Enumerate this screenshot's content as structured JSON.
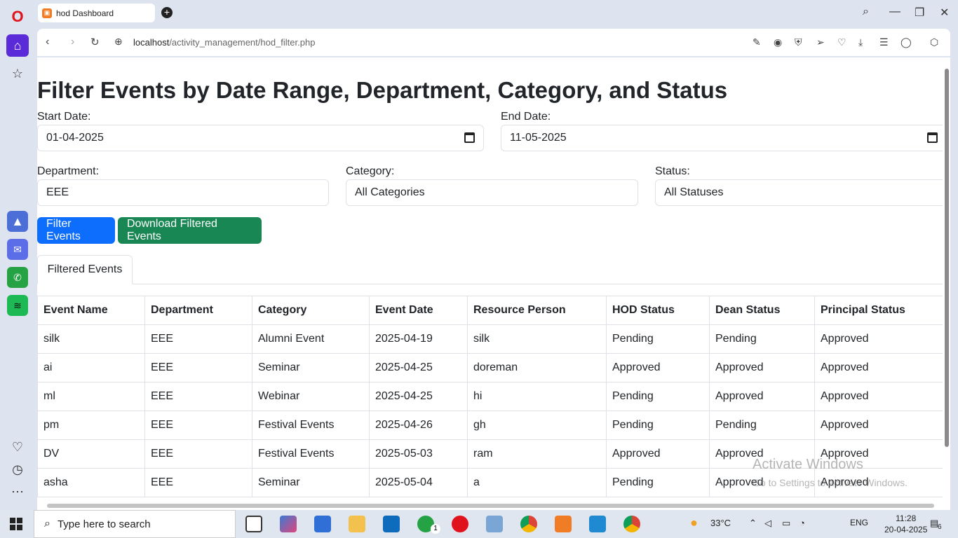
{
  "browser": {
    "tab_title": "hod Dashboard",
    "url_host": "localhost",
    "url_path": "/activity_management/hod_filter.php"
  },
  "page": {
    "title": "Filter Events by Date Range, Department, Category, and Status",
    "start_date_label": "Start Date:",
    "start_date_value": "01-04-2025",
    "end_date_label": "End Date:",
    "end_date_value": "11-05-2025",
    "department_label": "Department:",
    "department_value": "EEE",
    "category_label": "Category:",
    "category_value": "All Categories",
    "status_label": "Status:",
    "status_value": "All Statuses",
    "filter_button": "Filter Events",
    "download_button": "Download Filtered Events",
    "tab_label": "Filtered Events"
  },
  "table": {
    "headers": [
      "Event Name",
      "Department",
      "Category",
      "Event Date",
      "Resource Person",
      "HOD Status",
      "Dean Status",
      "Principal Status"
    ],
    "rows": [
      [
        "silk",
        "EEE",
        "Alumni Event",
        "2025-04-19",
        "silk",
        "Pending",
        "Pending",
        "Approved"
      ],
      [
        "ai",
        "EEE",
        "Seminar",
        "2025-04-25",
        "doreman",
        "Approved",
        "Approved",
        "Approved"
      ],
      [
        "ml",
        "EEE",
        "Webinar",
        "2025-04-25",
        "hi",
        "Pending",
        "Approved",
        "Approved"
      ],
      [
        "pm",
        "EEE",
        "Festival Events",
        "2025-04-26",
        "gh",
        "Pending",
        "Pending",
        "Approved"
      ],
      [
        "DV",
        "EEE",
        "Festival Events",
        "2025-05-03",
        "ram",
        "Approved",
        "Approved",
        "Approved"
      ],
      [
        "asha",
        "EEE",
        "Seminar",
        "2025-05-04",
        "a",
        "Pending",
        "Approved",
        "Approved"
      ]
    ]
  },
  "watermark": {
    "line1": "Activate Windows",
    "line2": "Go to Settings to activate Windows."
  },
  "taskbar": {
    "search_placeholder": "Type here to search",
    "temperature": "33°C",
    "language": "ENG",
    "time": "11:28",
    "date": "20-04-2025",
    "notifications": "6",
    "whatsapp_badge": "1"
  }
}
